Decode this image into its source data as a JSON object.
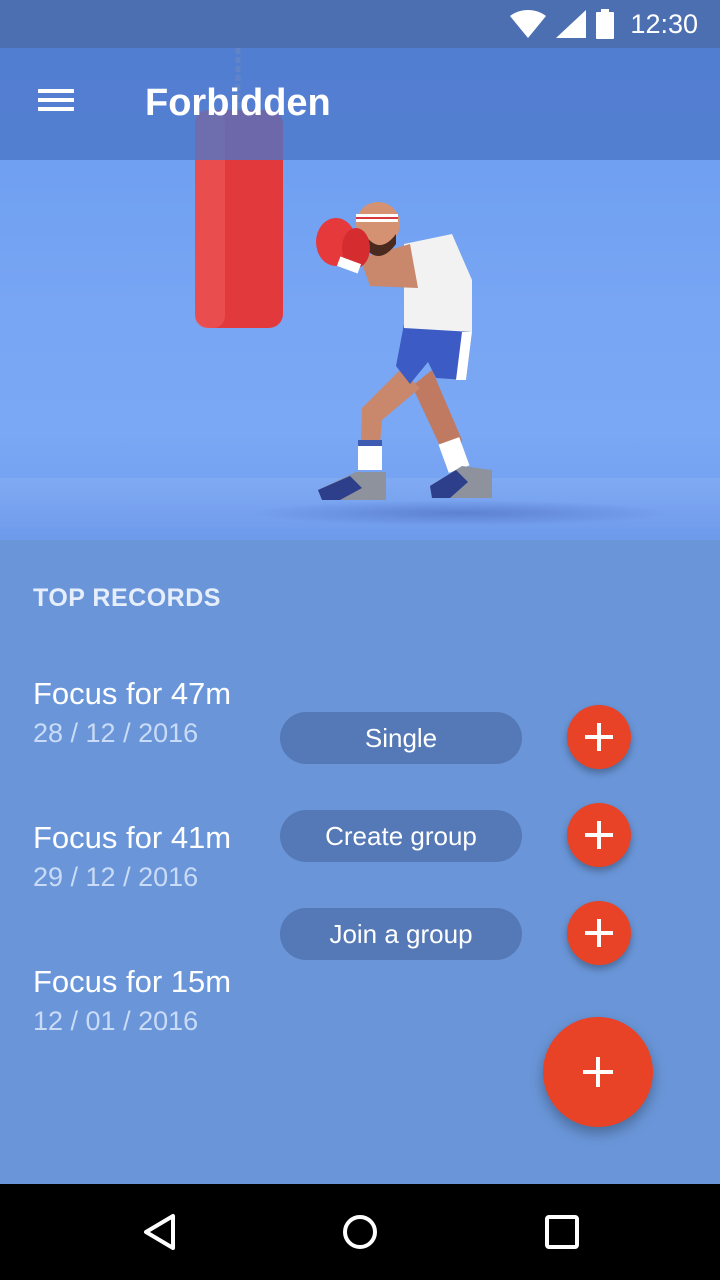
{
  "status_bar": {
    "time": "12:30",
    "icons": [
      "wifi-icon",
      "cell-signal-icon",
      "battery-icon"
    ]
  },
  "app_bar": {
    "title": "Forbidden",
    "menu_icon": "menu-icon"
  },
  "hero": {
    "illustration": "boxer-with-punching-bag"
  },
  "records": {
    "heading": "TOP RECORDS",
    "items": [
      {
        "title": "Focus for 47m",
        "date": "28 / 12 / 2016"
      },
      {
        "title": "Focus for 41m",
        "date": "29 / 12 / 2016"
      },
      {
        "title": "Focus for 15m",
        "date": "12 / 01 / 2016"
      }
    ]
  },
  "speed_dial": {
    "actions": [
      {
        "label": "Single",
        "icon": "plus-icon"
      },
      {
        "label": "Create group",
        "icon": "plus-icon"
      },
      {
        "label": "Join a group",
        "icon": "plus-icon"
      }
    ],
    "main_fab_icon": "plus-icon"
  },
  "colors": {
    "accent": "#e84326",
    "primary": "#6a96d9",
    "chip": "#5479b6",
    "app_bar": "#4b76c8"
  },
  "nav_bar": {
    "icons": [
      "back-icon",
      "home-icon",
      "recents-icon"
    ]
  }
}
